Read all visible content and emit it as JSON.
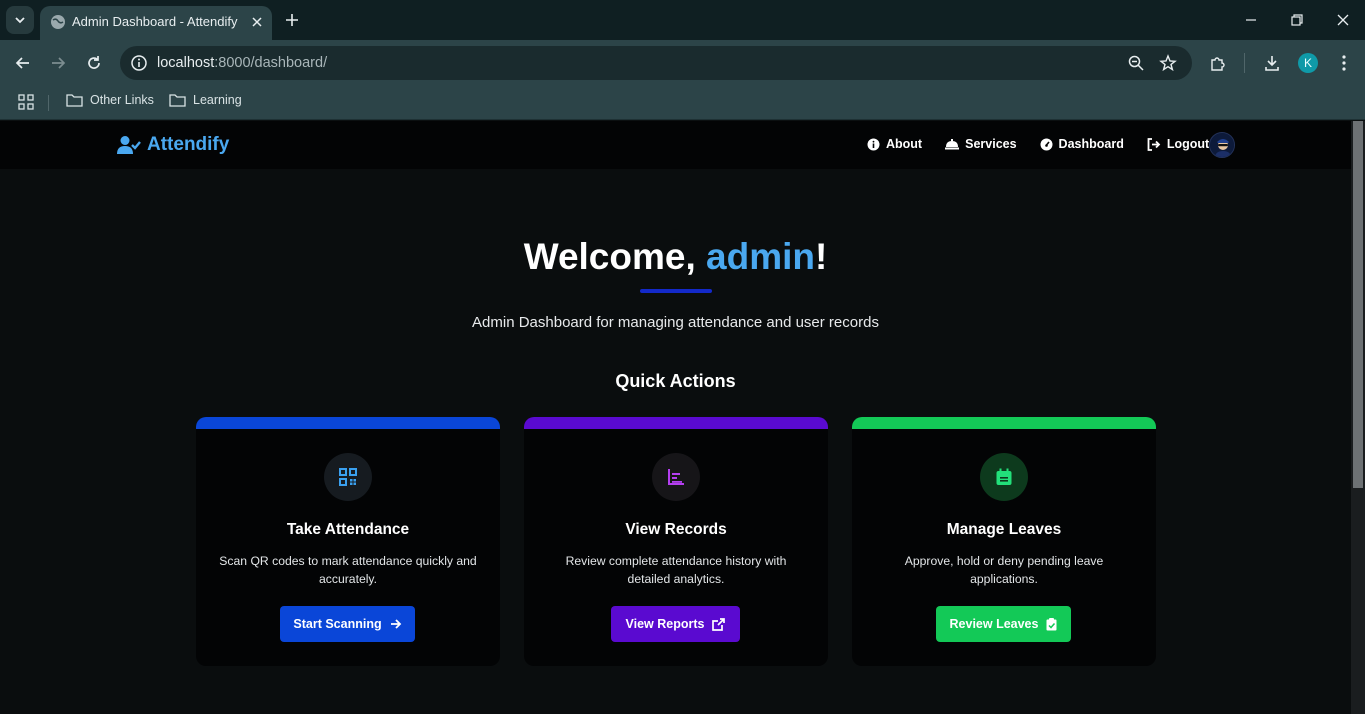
{
  "browser": {
    "tab_title": "Admin Dashboard - Attendify",
    "url_host": "localhost",
    "url_rest": ":8000/dashboard/",
    "profile_initial": "K",
    "bookmarks": [
      "Other Links",
      "Learning"
    ]
  },
  "navbar": {
    "brand": "Attendify",
    "links": [
      "About",
      "Services",
      "Dashboard",
      "Logout"
    ]
  },
  "hero": {
    "welcome_prefix": "Welcome, ",
    "username": "admin",
    "welcome_suffix": "!",
    "subtitle": "Admin Dashboard for managing attendance and user records"
  },
  "quick_actions": {
    "title": "Quick Actions",
    "cards": [
      {
        "title": "Take Attendance",
        "description": "Scan QR codes to mark attendance quickly and accurately.",
        "button": "Start Scanning",
        "accent": "#0a46d8",
        "icon": "qrcode-icon"
      },
      {
        "title": "View Records",
        "description": "Review complete attendance history with detailed analytics.",
        "button": "View Reports",
        "accent": "#5a0ad0",
        "icon": "chart-icon"
      },
      {
        "title": "Manage Leaves",
        "description": "Approve, hold or deny pending leave applications.",
        "button": "Review Leaves",
        "accent": "#13c957",
        "icon": "calendar-icon"
      }
    ]
  },
  "colors": {
    "brand": "#4aa8f0",
    "underline": "#1329c9",
    "page_bg": "#0a0d0e"
  }
}
